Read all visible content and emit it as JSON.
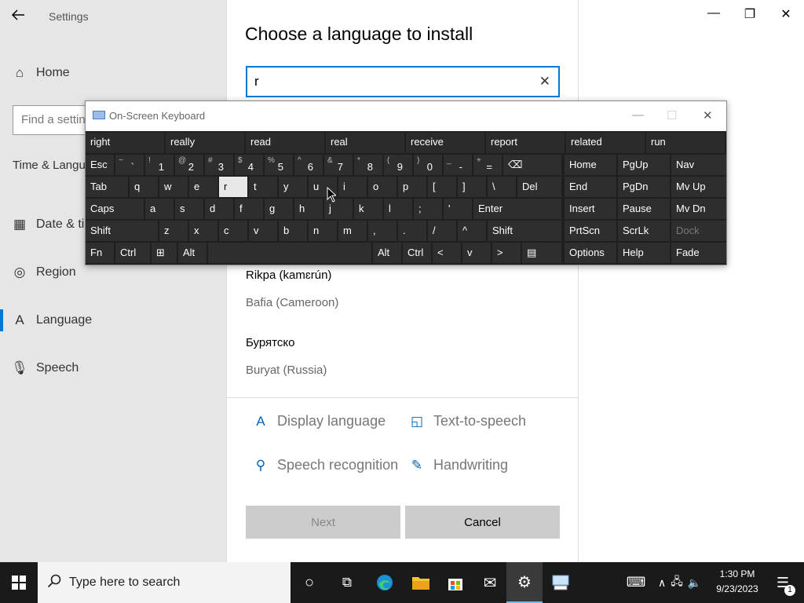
{
  "settings": {
    "title": "Settings",
    "home_label": "Home",
    "find_placeholder": "Find a setting",
    "section_label": "Time & Language",
    "nav": [
      {
        "label": "Date & time",
        "icon": "calendar-clock-icon"
      },
      {
        "label": "Region",
        "icon": "globe-icon"
      },
      {
        "label": "Language",
        "icon": "language-icon"
      },
      {
        "label": "Speech",
        "icon": "microphone-icon"
      }
    ]
  },
  "dialog": {
    "title": "Choose a language to install",
    "search_value": "r",
    "results": [
      {
        "native": "Rikpa (kamɛrún)",
        "english": "Bafia (Cameroon)"
      },
      {
        "native": "Бурятско",
        "english": "Buryat (Russia)"
      }
    ],
    "features": {
      "display_language": "Display language",
      "text_to_speech": "Text-to-speech",
      "speech_recognition": "Speech recognition",
      "handwriting": "Handwriting"
    },
    "next_label": "Next",
    "cancel_label": "Cancel"
  },
  "osk": {
    "title": "On-Screen Keyboard",
    "predictions": [
      "right",
      "really",
      "read",
      "real",
      "receive",
      "report",
      "related",
      "run"
    ],
    "row1": [
      {
        "label": "Esc"
      },
      {
        "sec": "~",
        "pri": "`"
      },
      {
        "sec": "!",
        "pri": "1"
      },
      {
        "sec": "@",
        "pri": "2"
      },
      {
        "sec": "#",
        "pri": "3"
      },
      {
        "sec": "$",
        "pri": "4"
      },
      {
        "sec": "%",
        "pri": "5"
      },
      {
        "sec": "^",
        "pri": "6"
      },
      {
        "sec": "&",
        "pri": "7"
      },
      {
        "sec": "*",
        "pri": "8"
      },
      {
        "sec": "(",
        "pri": "9"
      },
      {
        "sec": ")",
        "pri": "0"
      },
      {
        "sec": "_",
        "pri": "-"
      },
      {
        "sec": "+",
        "pri": "="
      },
      {
        "label": "⌫"
      }
    ],
    "row2": [
      "Tab",
      "q",
      "w",
      "e",
      "r",
      "t",
      "y",
      "u",
      "i",
      "o",
      "p",
      "[",
      "]",
      "\\",
      "Del"
    ],
    "row3": [
      "Caps",
      "a",
      "s",
      "d",
      "f",
      "g",
      "h",
      "j",
      "k",
      "l",
      ";",
      "'",
      "Enter"
    ],
    "row4": [
      "Shift",
      "z",
      "x",
      "c",
      "v",
      "b",
      "n",
      "m",
      ",",
      ".",
      "/",
      "^",
      "Shift"
    ],
    "row5": [
      "Fn",
      "Ctrl",
      "⊞",
      "Alt",
      "Alt",
      "Ctrl",
      "<",
      "v",
      ">",
      "▤"
    ],
    "nav_keys": [
      [
        "Home",
        "PgUp",
        "Nav"
      ],
      [
        "End",
        "PgDn",
        "Mv Up"
      ],
      [
        "Insert",
        "Pause",
        "Mv Dn"
      ],
      [
        "PrtScn",
        "ScrLk",
        "Dock"
      ],
      [
        "Options",
        "Help",
        "Fade"
      ]
    ]
  },
  "taskbar": {
    "search_placeholder": "Type here to search",
    "time": "1:30 PM",
    "date": "9/23/2023",
    "notification_count": "1"
  }
}
